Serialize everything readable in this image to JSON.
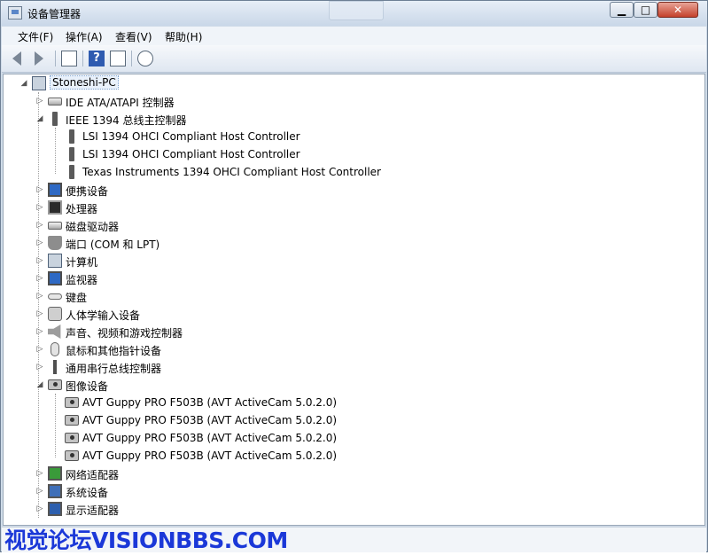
{
  "window": {
    "title": "设备管理器",
    "buttons": {
      "minimize": "▁",
      "maximize": "□",
      "close": "✕"
    }
  },
  "menu": [
    "文件(F)",
    "操作(A)",
    "查看(V)",
    "帮助(H)"
  ],
  "toolbar": {
    "icons": [
      "back-arrow-icon",
      "forward-arrow-icon",
      "show-hide-tree-icon",
      "help-icon",
      "properties-icon",
      "scan-hardware-icon"
    ],
    "help_glyph": "?"
  },
  "tree": {
    "root": "Stoneshi-PC",
    "rows": [
      {
        "label": "IDE ATA/ATAPI 控制器",
        "toggle": "▷",
        "icon": "ide-controller-icon",
        "level": 1
      },
      {
        "label": "IEEE 1394 总线主控制器",
        "toggle": "◢",
        "icon": "ieee1394-icon",
        "level": 1
      },
      {
        "label": "LSI 1394 OHCI Compliant Host Controller",
        "toggle": "",
        "icon": "ieee1394-device-icon",
        "level": 2
      },
      {
        "label": "LSI 1394 OHCI Compliant Host Controller",
        "toggle": "",
        "icon": "ieee1394-device-icon",
        "level": 2
      },
      {
        "label": "Texas Instruments 1394 OHCI Compliant Host Controller",
        "toggle": "",
        "icon": "ieee1394-device-icon",
        "level": 2
      },
      {
        "label": "便携设备",
        "toggle": "▷",
        "icon": "portable-device-icon",
        "level": 1
      },
      {
        "label": "处理器",
        "toggle": "▷",
        "icon": "processor-icon",
        "level": 1
      },
      {
        "label": "磁盘驱动器",
        "toggle": "▷",
        "icon": "disk-drive-icon",
        "level": 1
      },
      {
        "label": "端口 (COM 和 LPT)",
        "toggle": "▷",
        "icon": "port-icon",
        "level": 1
      },
      {
        "label": "计算机",
        "toggle": "▷",
        "icon": "computer-icon",
        "level": 1
      },
      {
        "label": "监视器",
        "toggle": "▷",
        "icon": "monitor-icon",
        "level": 1
      },
      {
        "label": "键盘",
        "toggle": "▷",
        "icon": "keyboard-icon",
        "level": 1
      },
      {
        "label": "人体学输入设备",
        "toggle": "▷",
        "icon": "hid-icon",
        "level": 1
      },
      {
        "label": "声音、视频和游戏控制器",
        "toggle": "▷",
        "icon": "sound-icon",
        "level": 1
      },
      {
        "label": "鼠标和其他指针设备",
        "toggle": "▷",
        "icon": "mouse-icon",
        "level": 1
      },
      {
        "label": "通用串行总线控制器",
        "toggle": "▷",
        "icon": "usb-icon",
        "level": 1
      },
      {
        "label": "图像设备",
        "toggle": "◢",
        "icon": "imaging-device-icon",
        "level": 1
      },
      {
        "label": "AVT Guppy PRO F503B (AVT ActiveCam 5.0.2.0)",
        "toggle": "",
        "icon": "camera-icon",
        "level": 2
      },
      {
        "label": "AVT Guppy PRO F503B (AVT ActiveCam 5.0.2.0)",
        "toggle": "",
        "icon": "camera-icon",
        "level": 2
      },
      {
        "label": "AVT Guppy PRO F503B (AVT ActiveCam 5.0.2.0)",
        "toggle": "",
        "icon": "camera-icon",
        "level": 2
      },
      {
        "label": "AVT Guppy PRO F503B (AVT ActiveCam 5.0.2.0)",
        "toggle": "",
        "icon": "camera-icon",
        "level": 2
      },
      {
        "label": "网络适配器",
        "toggle": "▷",
        "icon": "network-adapter-icon",
        "level": 1
      },
      {
        "label": "系统设备",
        "toggle": "▷",
        "icon": "system-device-icon",
        "level": 1
      },
      {
        "label": "显示适配器",
        "toggle": "▷",
        "icon": "display-adapter-icon",
        "level": 1
      }
    ]
  },
  "watermark": "视觉论坛VISIONBBS.COM",
  "colors": {
    "watermark": "#1b38d8",
    "selection_border": "#7fa3cf"
  }
}
